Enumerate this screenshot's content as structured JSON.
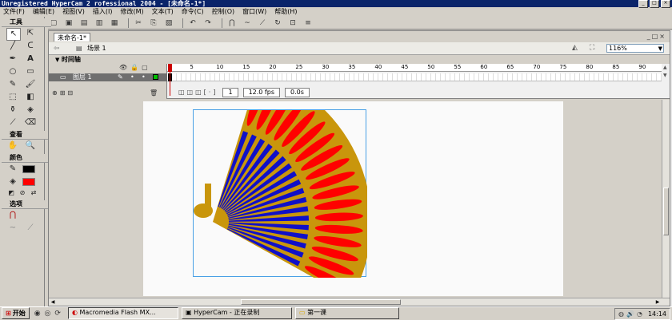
{
  "window": {
    "title": "Unregistered HyperCam 2 rofessional 2004 - [未命名-1*]"
  },
  "menubar": [
    "文件(F)",
    "编辑(E)",
    "视图(V)",
    "插入(I)",
    "修改(M)",
    "文本(T)",
    "命令(C)",
    "控制(O)",
    "窗口(W)",
    "帮助(H)"
  ],
  "toolbar": {
    "icons": [
      "new-file-icon",
      "open-folder-icon",
      "save-icon",
      "print-icon",
      "print-preview-icon",
      "cut-icon",
      "copy-icon",
      "paste-icon",
      "undo-icon",
      "redo-icon",
      "snap-magnet-icon",
      "smooth-icon",
      "straighten-icon",
      "rotate-icon",
      "scale-icon",
      "align-icon"
    ],
    "glyphs": [
      "▢",
      "▣",
      "▤",
      "▥",
      "▦",
      "✂",
      "⎘",
      "▧",
      "↶",
      "↷",
      "⋂",
      "~",
      "⟋",
      "↻",
      "⊡",
      "≡"
    ]
  },
  "tools_panel": {
    "title": "工具",
    "view_label": "查看",
    "colors_label": "颜色",
    "options_label": "选项",
    "stroke_color": "#000000",
    "fill_color": "#ff0000"
  },
  "document": {
    "tab_label": "未命名-1*",
    "scene_label": "场景 1",
    "zoom": "116%"
  },
  "timeline": {
    "header": "时间轴",
    "layer_name": "图层 1",
    "ticks": [
      "1",
      "5",
      "10",
      "15",
      "20",
      "25",
      "30",
      "35",
      "40",
      "45",
      "50",
      "55",
      "60",
      "65",
      "70",
      "75",
      "80",
      "85",
      "90"
    ],
    "current_frame": "1",
    "fps": "12.0 fps",
    "elapsed": "0.0s"
  },
  "artwork": {
    "description_colors": {
      "rim": "#c9960c",
      "outer_petal": "#ff0000",
      "inner_petal": "#1010c8",
      "handle": "#c9960c"
    },
    "petal_count": 18
  },
  "taskbar": {
    "start_label": "开始",
    "tasks": [
      "Macromedia Flash MX...",
      "HyperCam - 正在录制",
      "第一课"
    ],
    "clock": "14:14"
  }
}
